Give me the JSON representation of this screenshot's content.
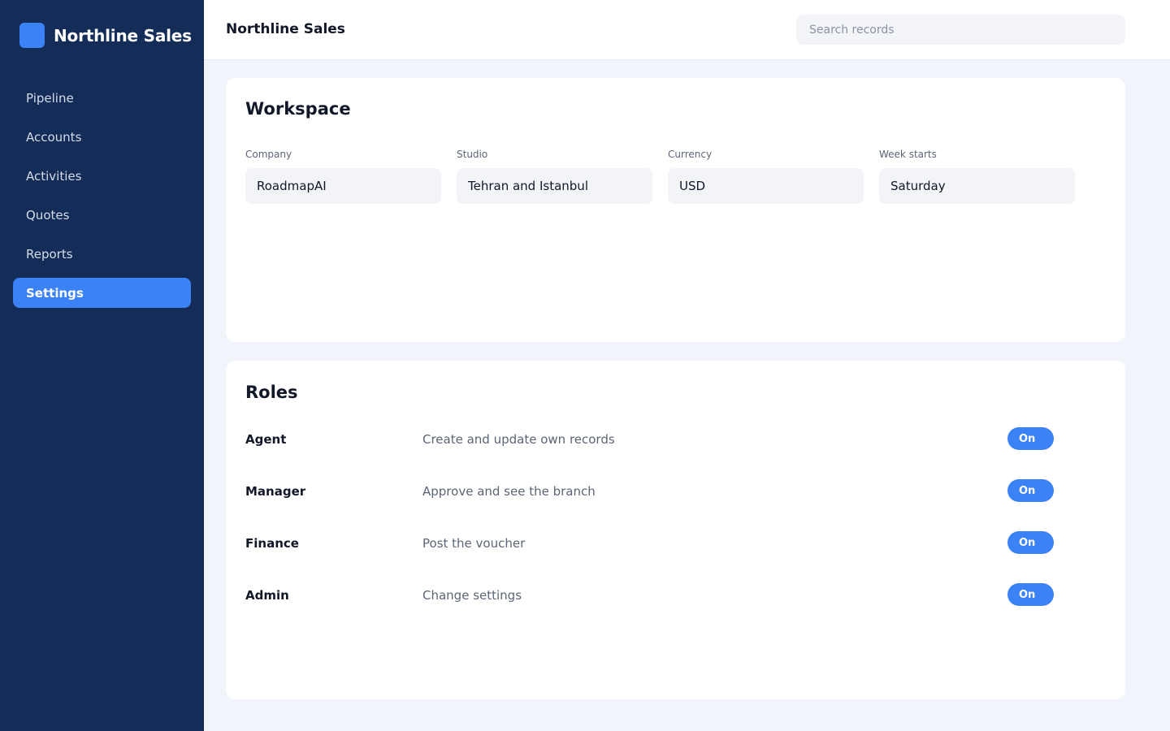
{
  "app": {
    "name": "Northline Sales"
  },
  "sidebar": {
    "items": [
      {
        "label": "Pipeline"
      },
      {
        "label": "Accounts"
      },
      {
        "label": "Activities"
      },
      {
        "label": "Quotes"
      },
      {
        "label": "Reports"
      },
      {
        "label": "Settings",
        "active": true
      }
    ]
  },
  "header": {
    "title": "Northline Sales",
    "search_placeholder": "Search records"
  },
  "workspace": {
    "title": "Workspace",
    "fields": [
      {
        "label": "Company",
        "value": "RoadmapAI"
      },
      {
        "label": "Studio",
        "value": "Tehran and Istanbul"
      },
      {
        "label": "Currency",
        "value": "USD"
      },
      {
        "label": "Week starts",
        "value": "Saturday"
      }
    ]
  },
  "roles": {
    "title": "Roles",
    "items": [
      {
        "name": "Agent",
        "description": "Create and update own records",
        "toggle": "On"
      },
      {
        "name": "Manager",
        "description": "Approve and see the branch",
        "toggle": "On"
      },
      {
        "name": "Finance",
        "description": "Post the voucher",
        "toggle": "On"
      },
      {
        "name": "Admin",
        "description": "Change settings",
        "toggle": "On"
      }
    ]
  },
  "colors": {
    "sidebar": "#142d58",
    "accent": "#3b82f6",
    "background": "#f1f5fb"
  }
}
